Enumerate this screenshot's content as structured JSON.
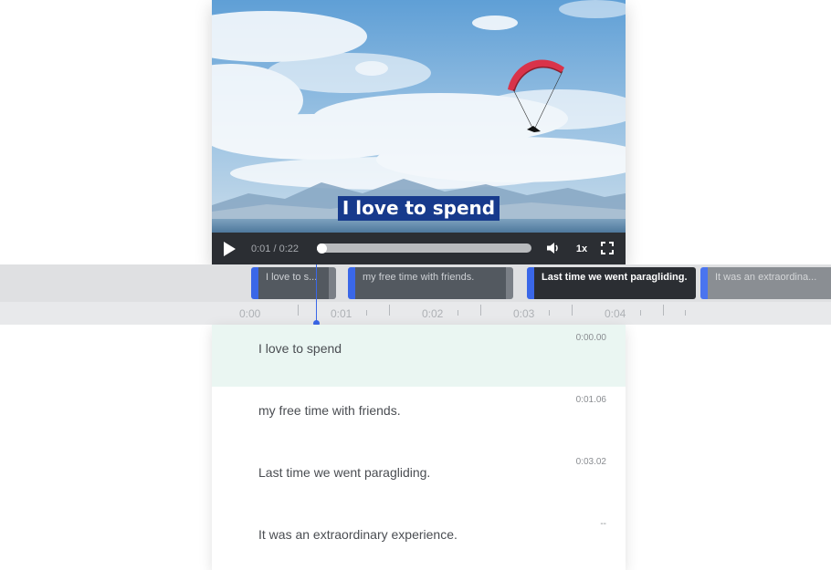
{
  "video": {
    "caption": "I love to spend",
    "time_display": "0:01 / 0:22",
    "progress_fraction": 0.02,
    "speed": "1x",
    "icons": {
      "play": "play-icon",
      "volume": "volume-icon",
      "fullscreen": "fullscreen-icon"
    }
  },
  "timeline": {
    "clips": [
      {
        "text": "I love to s..."
      },
      {
        "text": "my free time with friends."
      },
      {
        "text": "Last time we went paragliding."
      },
      {
        "text": "It was an extraordina..."
      }
    ],
    "ticks": [
      "0:00",
      "0:01",
      "0:02",
      "0:03",
      "0:04"
    ]
  },
  "transcript": {
    "rows": [
      {
        "text": "I love to spend",
        "time": "0:00.00"
      },
      {
        "text": "my free time with friends.",
        "time": "0:01.06"
      },
      {
        "text": "Last time we went paragliding.",
        "time": "0:03.02"
      },
      {
        "text": "It was an extraordinary experience.",
        "time": "--"
      }
    ]
  },
  "colors": {
    "accent": "#3a67e8",
    "caption_bg": "#173a8c",
    "selected_row": "#eaf6f2",
    "controls_bg": "#2b2e33"
  }
}
